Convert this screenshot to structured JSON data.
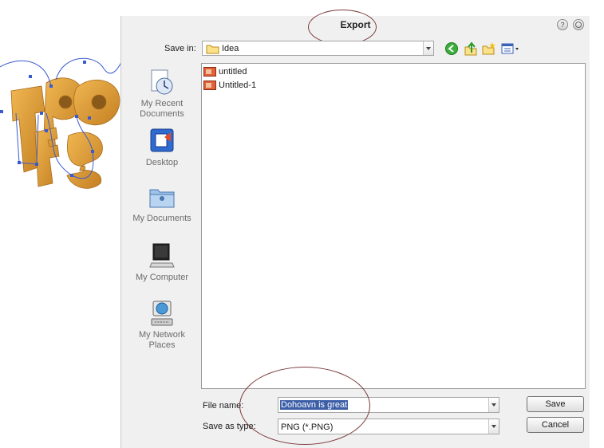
{
  "dialog": {
    "title": "Export",
    "help_glyph": "?",
    "save_in": {
      "label": "Save in:",
      "value": "Idea",
      "icon": "folder-icon"
    },
    "toolbar": [
      "back-icon",
      "up-folder-icon",
      "new-folder-icon",
      "views-menu-icon"
    ],
    "places": [
      {
        "label": "My Recent Documents",
        "icon": "recent-documents-icon"
      },
      {
        "label": "Desktop",
        "icon": "desktop-icon"
      },
      {
        "label": "My Documents",
        "icon": "my-documents-icon"
      },
      {
        "label": "My Computer",
        "icon": "computer-icon"
      },
      {
        "label": "My Network Places",
        "icon": "network-places-icon"
      }
    ],
    "files": [
      {
        "name": "untitled",
        "icon": "image-file-icon"
      },
      {
        "name": "Untitled-1",
        "icon": "image-file-icon"
      }
    ],
    "file_name": {
      "label": "File name:",
      "value": "Dohoavn is great"
    },
    "save_as_type": {
      "label": "Save as type:",
      "value": "PNG (*.PNG)"
    },
    "buttons": {
      "save": "Save",
      "cancel": "Cancel"
    }
  },
  "colors": {
    "dialog_bg": "#f0f0f0",
    "selection": "#3b5ea6",
    "annotation_ring": "#7a3a3a",
    "artwork_fill": "#e3a03a",
    "vector_path": "#3a5bd0"
  }
}
